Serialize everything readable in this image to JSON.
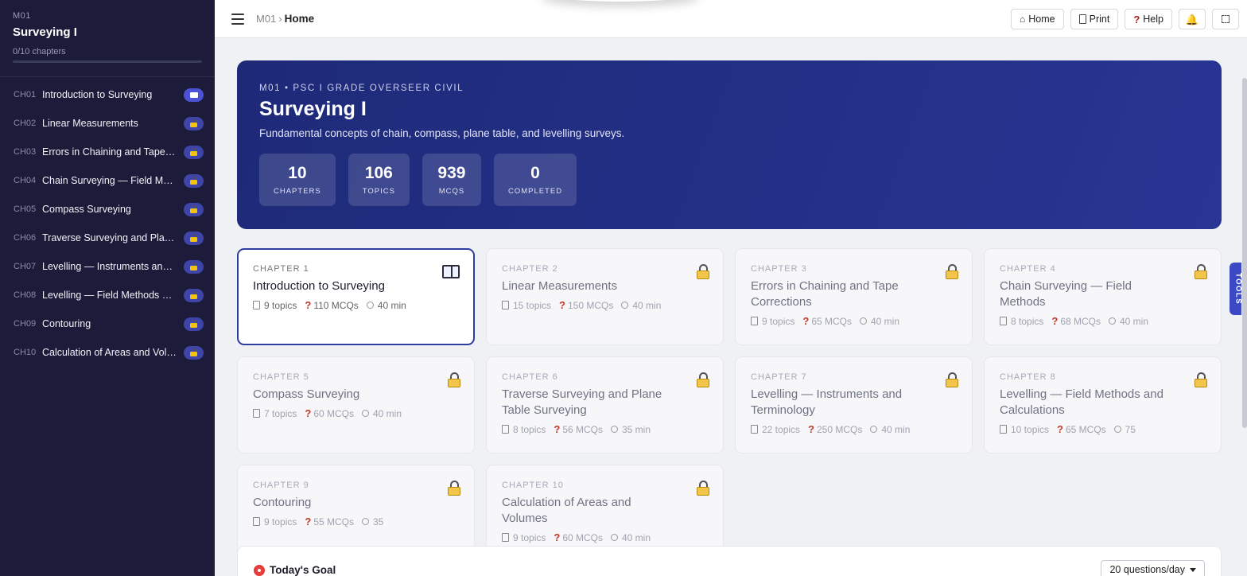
{
  "sidebar": {
    "module": "M01",
    "title": "Surveying I",
    "progress_text": "0/10 chapters",
    "progress_fraction": 0,
    "items": [
      {
        "code": "CH01",
        "label": "Introduction to Surveying",
        "status": "open"
      },
      {
        "code": "CH02",
        "label": "Linear Measurements",
        "status": "locked"
      },
      {
        "code": "CH03",
        "label": "Errors in Chaining and Tape Co...",
        "status": "locked"
      },
      {
        "code": "CH04",
        "label": "Chain Surveying — Field Meth...",
        "status": "locked"
      },
      {
        "code": "CH05",
        "label": "Compass Surveying",
        "status": "locked"
      },
      {
        "code": "CH06",
        "label": "Traverse Surveying and Plane T...",
        "status": "locked"
      },
      {
        "code": "CH07",
        "label": "Levelling — Instruments and T...",
        "status": "locked"
      },
      {
        "code": "CH08",
        "label": "Levelling — Field Methods an...",
        "status": "locked"
      },
      {
        "code": "CH09",
        "label": "Contouring",
        "status": "locked"
      },
      {
        "code": "CH10",
        "label": "Calculation of Areas and Volu...",
        "status": "locked"
      }
    ]
  },
  "topbar": {
    "crumb_module": "M01",
    "crumb_sep": "›",
    "crumb_current": "Home",
    "buttons": {
      "home": "Home",
      "print": "Print",
      "help": "Help"
    }
  },
  "hero": {
    "subtitle": "M01 • PSC I GRADE OVERSEER CIVIL",
    "title": "Surveying I",
    "description": "Fundamental concepts of chain, compass, plane table, and levelling surveys.",
    "stats": [
      {
        "value": "10",
        "label": "CHAPTERS"
      },
      {
        "value": "106",
        "label": "TOPICS"
      },
      {
        "value": "939",
        "label": "MCQS"
      },
      {
        "value": "0",
        "label": "COMPLETED"
      }
    ]
  },
  "chapters": [
    {
      "num": "CHAPTER 1",
      "title": "Introduction to Surveying",
      "topics": "9 topics",
      "mcqs": "110 MCQs",
      "time": "40 min",
      "status": "open"
    },
    {
      "num": "CHAPTER 2",
      "title": "Linear Measurements",
      "topics": "15 topics",
      "mcqs": "150 MCQs",
      "time": "40 min",
      "status": "locked"
    },
    {
      "num": "CHAPTER 3",
      "title": "Errors in Chaining and Tape Corrections",
      "topics": "9 topics",
      "mcqs": "65 MCQs",
      "time": "40 min",
      "status": "locked"
    },
    {
      "num": "CHAPTER 4",
      "title": "Chain Surveying — Field Methods",
      "topics": "8 topics",
      "mcqs": "68 MCQs",
      "time": "40 min",
      "status": "locked"
    },
    {
      "num": "CHAPTER 5",
      "title": "Compass Surveying",
      "topics": "7 topics",
      "mcqs": "60 MCQs",
      "time": "40 min",
      "status": "locked"
    },
    {
      "num": "CHAPTER 6",
      "title": "Traverse Surveying and Plane Table Surveying",
      "topics": "8 topics",
      "mcqs": "56 MCQs",
      "time": "35 min",
      "status": "locked"
    },
    {
      "num": "CHAPTER 7",
      "title": "Levelling — Instruments and Terminology",
      "topics": "22 topics",
      "mcqs": "250 MCQs",
      "time": "40 min",
      "status": "locked"
    },
    {
      "num": "CHAPTER 8",
      "title": "Levelling — Field Methods and Calculations",
      "topics": "10 topics",
      "mcqs": "65 MCQs",
      "time": "75",
      "status": "locked"
    },
    {
      "num": "CHAPTER 9",
      "title": "Contouring",
      "topics": "9 topics",
      "mcqs": "55 MCQs",
      "time": "35",
      "status": "locked"
    },
    {
      "num": "CHAPTER 10",
      "title": "Calculation of Areas and Volumes",
      "topics": "9 topics",
      "mcqs": "60 MCQs",
      "time": "40 min",
      "status": "locked"
    }
  ],
  "goal": {
    "title": "Today's Goal",
    "select_value": "20 questions/day"
  },
  "tools_label": "TOOLS",
  "colors": {
    "sidebar_bg": "#1c1c3a",
    "hero_bg": "#283593",
    "accent": "#2f3d9e",
    "lock_yellow": "#f3c64b"
  },
  "icons": {
    "menu": "hamburger-icon",
    "home": "house-icon",
    "print": "document-icon",
    "help": "question-icon",
    "notifications": "bell-icon",
    "fullscreen": "fullscreen-icon",
    "open_chapter": "book-icon",
    "locked_chapter": "lock-icon",
    "goal": "target-icon"
  }
}
